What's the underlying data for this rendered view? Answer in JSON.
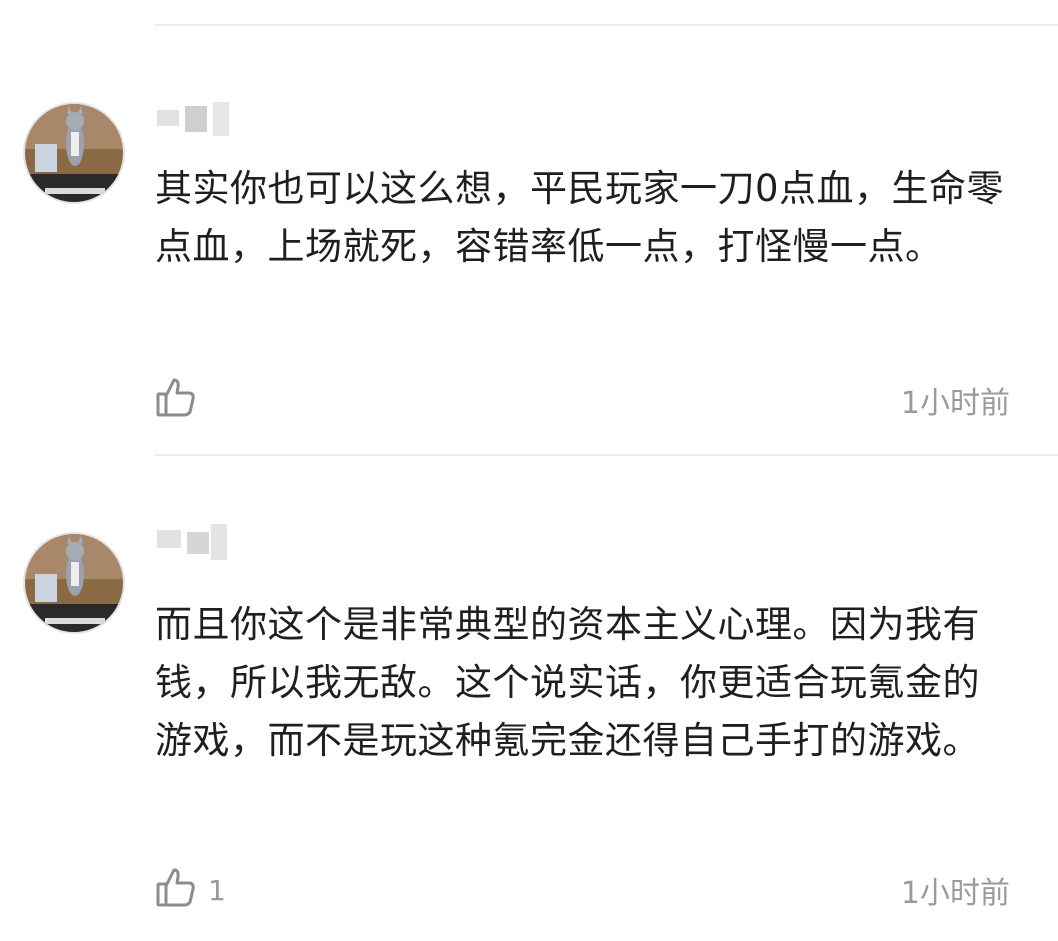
{
  "comments": [
    {
      "avatar_icon": "cat-photo-avatar",
      "username": "",
      "text": "其实你也可以这么想，平民玩家一刀0点血，生命零点血，上场就死，容错率低一点，打怪慢一点。",
      "like_icon": "thumbs-up-icon",
      "like_count": "",
      "time": "1小时前"
    },
    {
      "avatar_icon": "cat-photo-avatar",
      "username": "",
      "text": "而且你这个是非常典型的资本主义心理。因为我有钱，所以我无敌。这个说实话，你更适合玩氪金的游戏，而不是玩这种氪完金还得自己手打的游戏。",
      "like_icon": "thumbs-up-icon",
      "like_count": "1",
      "time": "1小时前"
    }
  ],
  "colors": {
    "text": "#1f1f1f",
    "meta": "#9a9a9a",
    "divider": "#ececec"
  }
}
